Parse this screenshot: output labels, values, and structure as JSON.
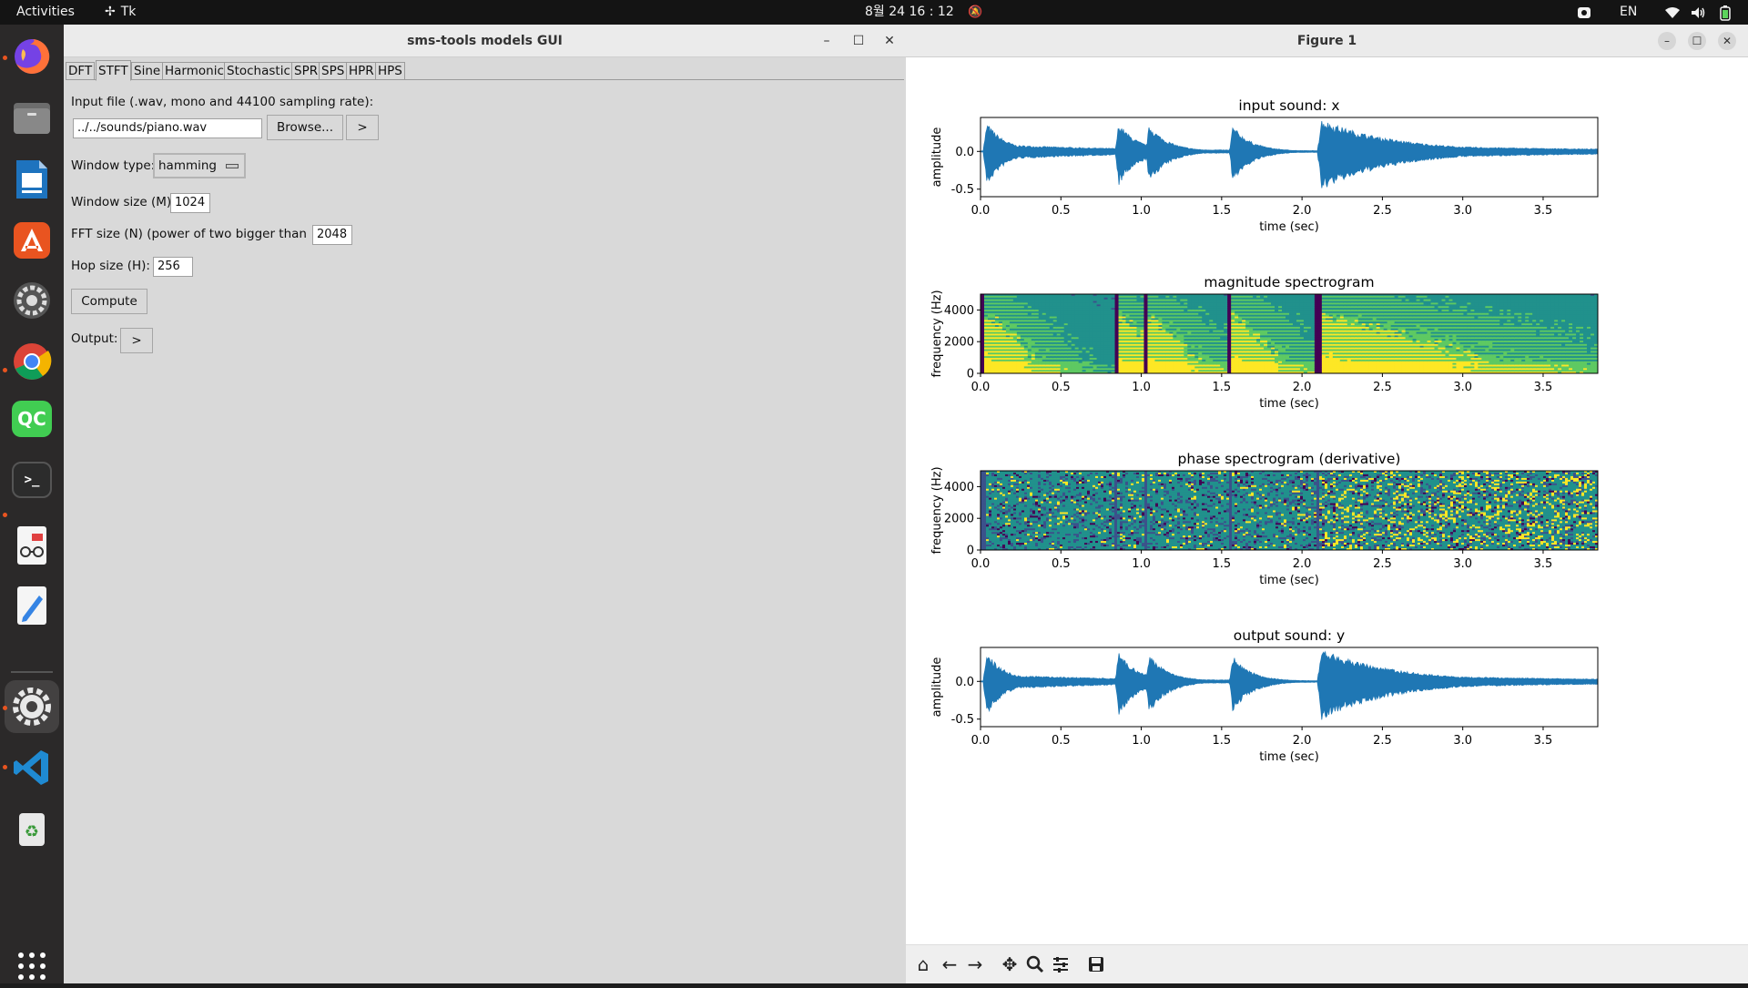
{
  "topbar": {
    "activities": "Activities",
    "app_indicator": "Tk",
    "clock": "8월 24  16 : 12",
    "language": "EN"
  },
  "dock": {
    "items": [
      "firefox",
      "files",
      "libreoffice-impress",
      "app-center",
      "system-settings",
      "chrome",
      "qt-creator",
      "terminal",
      "document-viewer",
      "text-editor",
      "settings-active",
      "vscode",
      "trash",
      "show-apps"
    ]
  },
  "tk_window": {
    "title": "sms-tools models GUI",
    "tabs": [
      "DFT",
      "STFT",
      "Sine",
      "Harmonic",
      "Stochastic",
      "SPR",
      "SPS",
      "HPR",
      "HPS"
    ],
    "active_tab": "STFT",
    "input_label": "Input file (.wav, mono and 44100 sampling rate):",
    "input_value": "../../sounds/piano.wav",
    "browse_label": "Browse...",
    "play_input_label": ">",
    "window_type_label": "Window type:",
    "window_type_value": "hamming",
    "window_size_label": "Window size (M)",
    "window_size_value": "1024",
    "fft_size_label": "FFT size (N) (power of two bigger than M",
    "fft_size_value": "2048",
    "hop_size_label": "Hop size (H):",
    "hop_size_value": "256",
    "compute_label": "Compute",
    "output_label": "Output:",
    "play_output_label": ">"
  },
  "figure_window": {
    "title": "Figure 1"
  },
  "colors": {
    "plot_blue": "#1f77b4",
    "accent_orange": "#e95420"
  },
  "chart_data": [
    {
      "type": "line",
      "title": "input sound: x",
      "xlabel": "time (sec)",
      "ylabel": "amplitude",
      "xlim": [
        0,
        3.84
      ],
      "ylim": [
        -0.6,
        0.45
      ],
      "xticks": [
        "0.0",
        "0.5",
        "1.0",
        "1.5",
        "2.0",
        "2.5",
        "3.0",
        "3.5"
      ],
      "yticks": [
        "0.0",
        "-0.5"
      ],
      "note_onsets": [
        0.02,
        0.84,
        1.03,
        1.55,
        2.1
      ],
      "note_peaks": [
        0.45,
        0.45,
        0.42,
        0.4,
        0.45
      ]
    },
    {
      "type": "heatmap",
      "title": "magnitude spectrogram",
      "xlabel": "time (sec)",
      "ylabel": "frequency (Hz)",
      "xlim": [
        0,
        3.84
      ],
      "ylim": [
        0,
        5000
      ],
      "xticks": [
        "0.0",
        "0.5",
        "1.0",
        "1.5",
        "2.0",
        "2.5",
        "3.0",
        "3.5"
      ],
      "yticks": [
        "4000",
        "2000",
        "0"
      ]
    },
    {
      "type": "heatmap",
      "title": "phase spectrogram (derivative)",
      "xlabel": "time (sec)",
      "ylabel": "frequency (Hz)",
      "xlim": [
        0,
        3.84
      ],
      "ylim": [
        0,
        5000
      ],
      "xticks": [
        "0.0",
        "0.5",
        "1.0",
        "1.5",
        "2.0",
        "2.5",
        "3.0",
        "3.5"
      ],
      "yticks": [
        "4000",
        "2000",
        "0"
      ]
    },
    {
      "type": "line",
      "title": "output sound: y",
      "xlabel": "time (sec)",
      "ylabel": "amplitude",
      "xlim": [
        0,
        3.84
      ],
      "ylim": [
        -0.6,
        0.45
      ],
      "xticks": [
        "0.0",
        "0.5",
        "1.0",
        "1.5",
        "2.0",
        "2.5",
        "3.0",
        "3.5"
      ],
      "yticks": [
        "0.0",
        "-0.5"
      ],
      "note_onsets": [
        0.02,
        0.84,
        1.03,
        1.55,
        2.1
      ],
      "note_peaks": [
        0.45,
        0.45,
        0.42,
        0.4,
        0.45
      ]
    }
  ]
}
